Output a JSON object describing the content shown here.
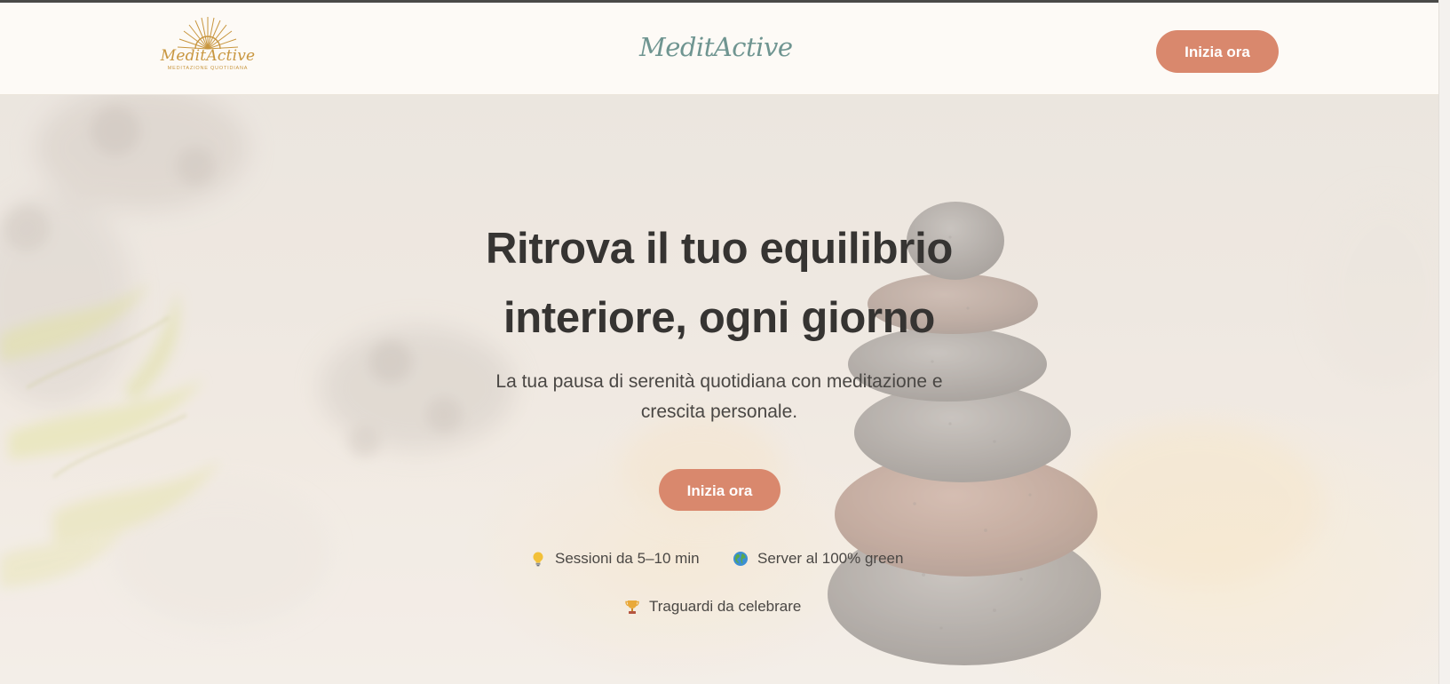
{
  "header": {
    "logo": {
      "script": "MeditActive",
      "tagline": "MEDITAZIONE QUOTIDIANA"
    },
    "brand_name": "MeditActive",
    "cta_label": "Inizia ora"
  },
  "hero": {
    "title_line1": "Ritrova il tuo equilibrio",
    "title_line2": "interiore, ogni giorno",
    "subtitle_line1": "La tua pausa di serenità quotidiana con meditazione e",
    "subtitle_line2": "crescita personale.",
    "cta_label": "Inizia ora",
    "features": [
      {
        "icon": "lightbulb-icon",
        "label": "Sessioni da 5–10 min"
      },
      {
        "icon": "globe-icon",
        "label": "Server al 100% green"
      },
      {
        "icon": "trophy-icon",
        "label": "Traguardi da celebrare"
      }
    ]
  },
  "colors": {
    "accent": "#d9886d",
    "brand_teal": "#6f9591",
    "logo_gold": "#c8963f",
    "text_dark": "#363432",
    "header_bg": "#fdfaf6"
  }
}
